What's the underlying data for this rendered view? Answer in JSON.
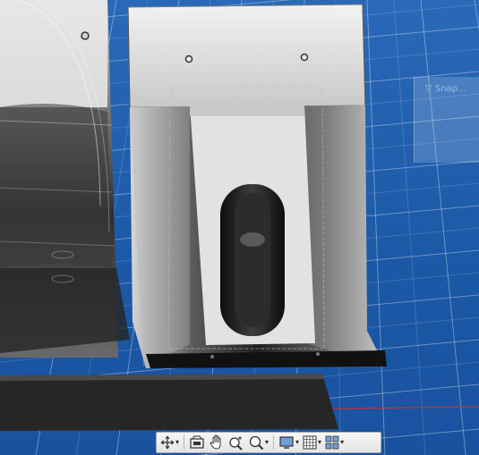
{
  "viewport": {
    "background": "#1f5fb0",
    "grid_color": "#ffffff",
    "axis_color": "#c83232",
    "faint_panel_text": "▽ Snap..."
  },
  "navbar": {
    "items": [
      {
        "icon": "orbit-icon",
        "has_dropdown": true
      },
      {
        "icon": "look-at-icon",
        "has_dropdown": false
      },
      {
        "icon": "pan-icon",
        "has_dropdown": false
      },
      {
        "icon": "zoom-icon",
        "has_dropdown": false
      },
      {
        "icon": "zoom-window-icon",
        "has_dropdown": true
      },
      {
        "icon": "display-settings-icon",
        "has_dropdown": true
      },
      {
        "icon": "grid-settings-icon",
        "has_dropdown": true
      },
      {
        "icon": "viewports-icon",
        "has_dropdown": true
      }
    ],
    "caret": "▾"
  }
}
